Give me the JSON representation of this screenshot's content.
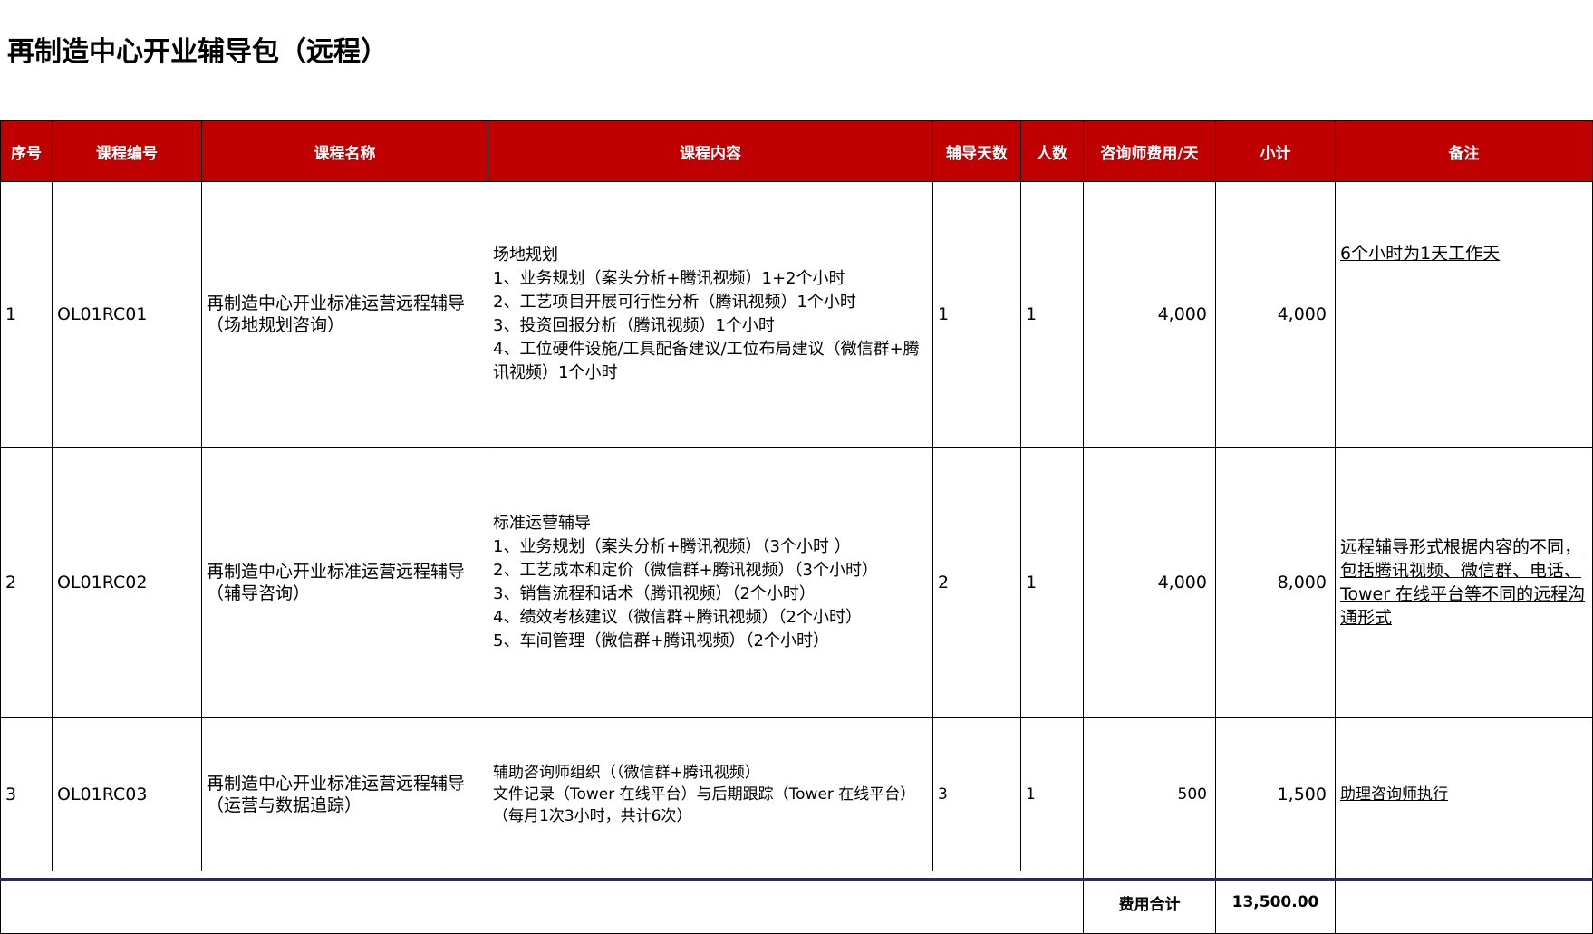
{
  "title": "再制造中心开业辅导包（远程）",
  "headers": [
    "序号",
    "课程编号",
    "课程名称",
    "课程内容",
    "辅导天数",
    "人数",
    "咨询师费用/天",
    "小计",
    "备注"
  ],
  "rows": [
    {
      "no": "1",
      "code": "OL01RC01",
      "name": "再制造中心开业标准运营远程辅导（场地规划咨询）",
      "content": [
        "场地规划",
        "1、业务规划（案头分析+腾讯视频）1+2个小时",
        "2、工艺项目开展可行性分析（腾讯视频）1个小时",
        "3、投资回报分析（腾讯视频）1个小时",
        "4、工位硬件设施/工具配备建议/工位布局建议（微信群+腾讯视频）1个小时"
      ],
      "days": "1",
      "people": "1",
      "fee": "4,000",
      "subtotal": "4,000",
      "note": "6个小时为1天工作天"
    },
    {
      "no": "2",
      "code": "OL01RC02",
      "name": "再制造中心开业标准运营远程辅导（辅导咨询）",
      "content": [
        "标准运营辅导",
        "1、业务规划（案头分析+腾讯视频）（3个小时 ）",
        "2、工艺成本和定价（微信群+腾讯视频）（3个小时）",
        "3、销售流程和话术（腾讯视频）（2个小时）",
        "4、绩效考核建议（微信群+腾讯视频）（2个小时）",
        "5、车间管理（微信群+腾讯视频）（2个小时）"
      ],
      "days": "2",
      "people": "1",
      "fee": "4,000",
      "subtotal": "8,000",
      "note": "远程辅导形式根据内容的不同，包括腾讯视频、微信群、电话、Tower 在线平台等不同的远程沟通形式"
    },
    {
      "no": "3",
      "code": "OL01RC03",
      "name": "再制造中心开业标准运营远程辅导（运营与数据追踪）",
      "content": [
        "辅助咨询师组织（（微信群+腾讯视频）",
        "文件记录（Tower 在线平台）与后期跟踪（Tower 在线平台）（每月1次3小时，共计6次）"
      ],
      "days": "3",
      "people": "1",
      "fee": "500",
      "subtotal": "1,500",
      "note": "助理咨询师执行"
    }
  ],
  "total_label": "费用合计",
  "total_value": "13,500.00"
}
